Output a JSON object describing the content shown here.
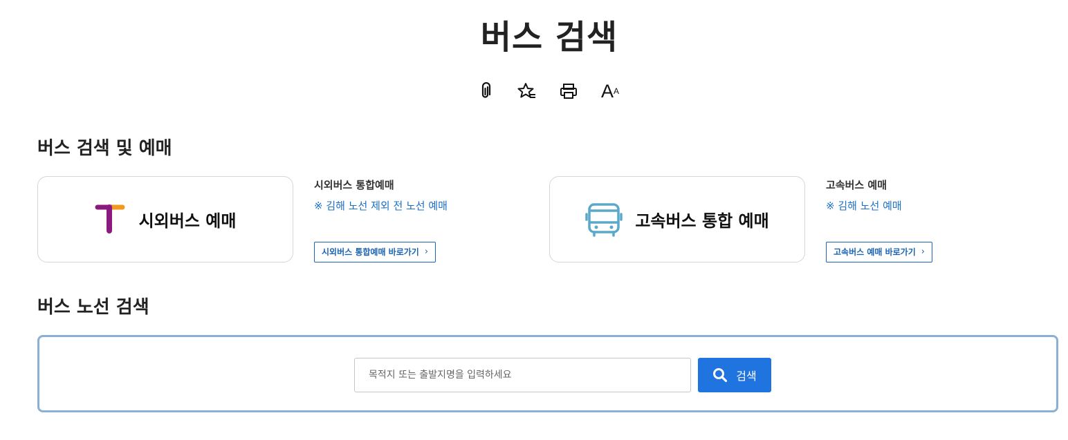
{
  "page": {
    "title": "버스 검색"
  },
  "utility_icons": [
    "paperclip-icon",
    "star-bookmark-icon",
    "print-icon",
    "font-size-icon"
  ],
  "font_size_icon": {
    "big": "A",
    "small": "A"
  },
  "booking_section": {
    "title": "버스 검색 및 예매",
    "intercity": {
      "card_label": "시외버스 예매",
      "logo_colors": {
        "purple": "#8b1a7d",
        "orange": "#f29a1f"
      },
      "info_title": "시외버스 통합예매",
      "info_note": "※ 김해 노선 제외 전 노선 예매",
      "link_label": "시외버스 통합예매 바로가기",
      "link_chevron": "›"
    },
    "express": {
      "card_label": "고속버스 통합 예매",
      "icon_color": "#5aa9c8",
      "info_title": "고속버스 예매",
      "info_note": "※ 김해 노선 예매",
      "link_label": "고속버스 예매 바로가기",
      "link_chevron": "›"
    }
  },
  "route_section": {
    "title": "버스 노선 검색",
    "search_placeholder": "목적지 또는 출발지명을 입력하세요",
    "search_value": "",
    "search_button_label": "검색"
  },
  "colors": {
    "accent_blue": "#1f74e0",
    "link_blue": "#1a63b4",
    "note_blue": "#1a6fc9",
    "search_border": "#8bafd6"
  }
}
